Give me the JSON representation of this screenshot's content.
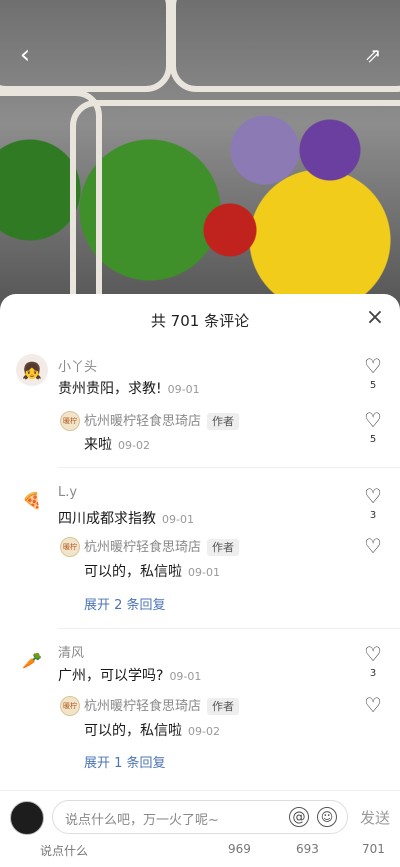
{
  "header": {
    "back_icon": "chevron-left-icon",
    "share_icon": "share-out-icon"
  },
  "panel": {
    "title": "共 701 条评论",
    "close_icon": "close-icon"
  },
  "comments": [
    {
      "user": "小丫头",
      "text": "贵州贵阳，求教!",
      "time": "09-01",
      "likes": "5",
      "replies": [
        {
          "user": "杭州暖柠轻食思琦店",
          "badge": "作者",
          "text": "来啦",
          "time": "09-02",
          "likes": "5"
        }
      ]
    },
    {
      "user": "L.y",
      "text": "四川成都求指教",
      "time": "09-01",
      "likes": "3",
      "replies": [
        {
          "user": "杭州暖柠轻食思琦店",
          "badge": "作者",
          "text": "可以的，私信啦",
          "time": "09-01",
          "likes": ""
        }
      ],
      "expand": "展开 2 条回复"
    },
    {
      "user": "清风",
      "text": "广州，可以学吗?",
      "time": "09-01",
      "likes": "3",
      "replies": [
        {
          "user": "杭州暖柠轻食思琦店",
          "badge": "作者",
          "text": "可以的，私信啦",
          "time": "09-02",
          "likes": ""
        }
      ],
      "expand": "展开 1 条回复"
    }
  ],
  "input": {
    "placeholder": "说点什么吧，万一火了呢~",
    "send_label": "发送"
  },
  "behind_bar": {
    "hint": "说点什么",
    "n1": "969",
    "n2": "693",
    "n3": "701"
  },
  "colors": {
    "accent_link": "#4b74b5",
    "author_badge_bg": "#eeeeee"
  }
}
